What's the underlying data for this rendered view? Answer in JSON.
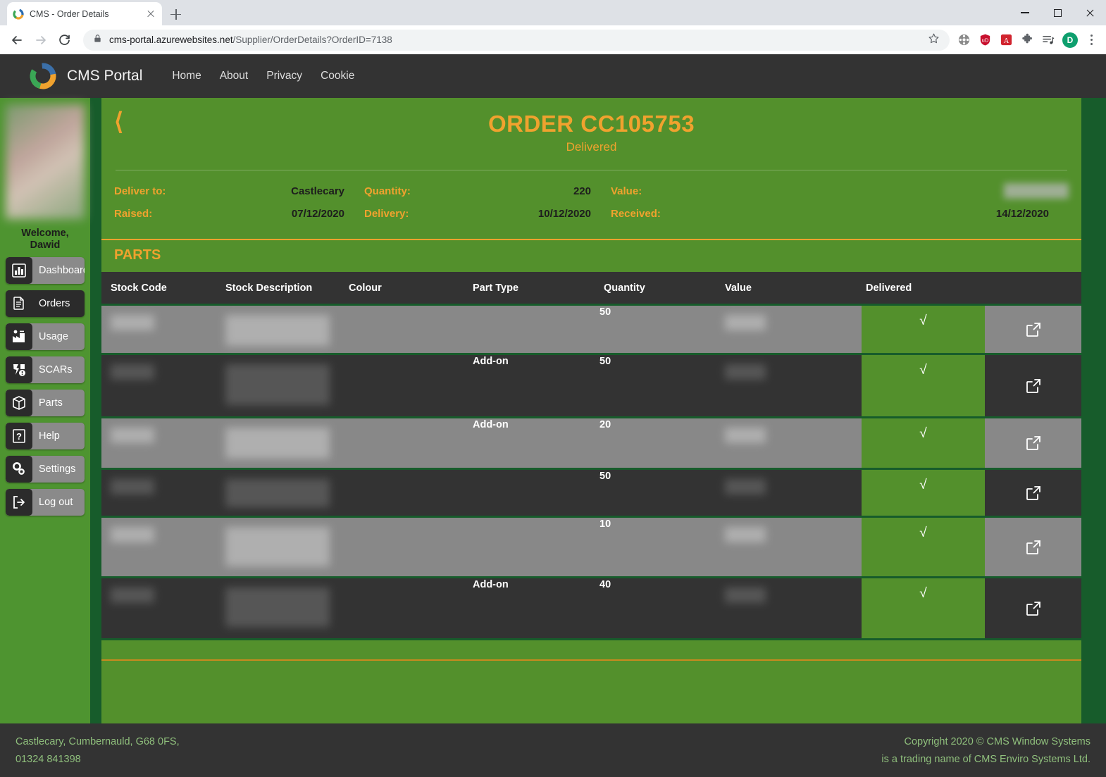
{
  "browser": {
    "tab_title": "CMS - Order Details",
    "favicon": "cms-ring-icon",
    "url_host": "cms-portal.azurewebsites.net",
    "url_path": "/Supplier/OrderDetails?OrderID=7138",
    "back_icon": "back-arrow-icon",
    "forward_icon": "forward-arrow-icon",
    "reload_icon": "reload-icon",
    "lock_icon": "lock-icon",
    "bookmark_icon": "star-icon",
    "extensions": [
      "film-reel-icon",
      "ublock-shield-icon",
      "adobe-pdf-icon",
      "puzzle-extension-icon",
      "media-playlist-icon"
    ],
    "profile_initial": "D",
    "menu_icon": "kebab-menu-icon",
    "window_controls": [
      "minimize",
      "maximize",
      "close"
    ]
  },
  "navbar": {
    "brand": "CMS Portal",
    "links": [
      "Home",
      "About",
      "Privacy",
      "Cookie"
    ]
  },
  "sidebar": {
    "welcome_line1": "Welcome,",
    "welcome_line2": "Dawid",
    "avatar": "user-profile-photo",
    "items": [
      {
        "label": "Dashboard",
        "icon": "bar-chart-icon",
        "active": false
      },
      {
        "label": "Orders",
        "icon": "document-icon",
        "active": true
      },
      {
        "label": "Usage",
        "icon": "factory-icon",
        "active": false
      },
      {
        "label": "SCARs",
        "icon": "broken-part-alert-icon",
        "active": false
      },
      {
        "label": "Parts",
        "icon": "box-icon",
        "active": false
      },
      {
        "label": "Help",
        "icon": "question-mark-icon",
        "active": false
      },
      {
        "label": "Settings",
        "icon": "gears-icon",
        "active": false
      },
      {
        "label": "Log out",
        "icon": "logout-arrow-icon",
        "active": false
      }
    ]
  },
  "order": {
    "back_icon": "chevron-left-icon",
    "title": "ORDER CC105753",
    "status": "Delivered",
    "meta": [
      [
        {
          "key": "Deliver to:",
          "value": "Castlecary",
          "redacted": false
        },
        {
          "key": "Quantity:",
          "value": "220",
          "redacted": false
        },
        {
          "key": "Value:",
          "value": "",
          "redacted": true
        }
      ],
      [
        {
          "key": "Raised:",
          "value": "07/12/2020",
          "redacted": false
        },
        {
          "key": "Delivery:",
          "value": "10/12/2020",
          "redacted": false
        },
        {
          "key": "Received:",
          "value": "14/12/2020",
          "redacted": false
        }
      ]
    ]
  },
  "parts": {
    "section_title": "PARTS",
    "columns": [
      "Stock Code",
      "Stock Description",
      "Colour",
      "Part Type",
      "Quantity",
      "Value",
      "Delivered"
    ],
    "open_icon": "external-link-icon",
    "delivered_mark": "√",
    "rows": [
      {
        "stock_code": "",
        "stock_description": "",
        "colour": "",
        "part_type": "",
        "quantity": "50",
        "value": "",
        "delivered": true,
        "redacted": true
      },
      {
        "stock_code": "",
        "stock_description": "",
        "colour": "",
        "part_type": "Add-on",
        "quantity": "50",
        "value": "",
        "delivered": true,
        "redacted": true
      },
      {
        "stock_code": "",
        "stock_description": "",
        "colour": "",
        "part_type": "Add-on",
        "quantity": "20",
        "value": "",
        "delivered": true,
        "redacted": true
      },
      {
        "stock_code": "",
        "stock_description": "",
        "colour": "",
        "part_type": "",
        "quantity": "50",
        "value": "",
        "delivered": true,
        "redacted": true
      },
      {
        "stock_code": "",
        "stock_description": "",
        "colour": "",
        "part_type": "",
        "quantity": "10",
        "value": "",
        "delivered": true,
        "redacted": true
      },
      {
        "stock_code": "",
        "stock_description": "",
        "colour": "",
        "part_type": "Add-on",
        "quantity": "40",
        "value": "",
        "delivered": true,
        "redacted": true
      }
    ]
  },
  "footer": {
    "address": "Castlecary, Cumbernauld, G68 0FS,",
    "phone": "01324 841398",
    "copyright": "Copyright 2020 © CMS Window Systems",
    "trading": "is a trading name of CMS Enviro Systems Ltd."
  },
  "colors": {
    "brand_green": "#53902c",
    "dark_green": "#175c2b",
    "sidebar_green": "#4e9430",
    "accent_orange": "#f0a22e",
    "row_dark": "#333333",
    "row_light": "#888888",
    "footer_text": "#8fbf7c"
  }
}
